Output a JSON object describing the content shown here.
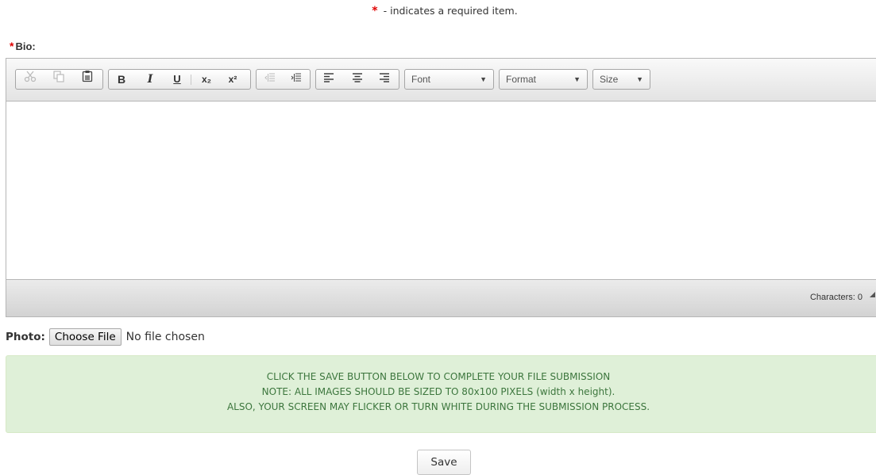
{
  "required_note": {
    "star": "*",
    "text": "- indicates a required item."
  },
  "bio": {
    "star": "*",
    "label": "Bio:"
  },
  "toolbar": {
    "cut_icon": "scissors-icon",
    "copy_icon": "copy-icon",
    "paste_icon": "paste-icon",
    "bold": "B",
    "italic": "I",
    "underline": "U",
    "subscript": "x₂",
    "superscript": "x²",
    "outdent_icon": "outdent-icon",
    "indent_icon": "indent-icon",
    "align_left_icon": "align-left-icon",
    "align_center_icon": "align-center-icon",
    "align_right_icon": "align-right-icon",
    "font": "Font",
    "format": "Format",
    "size": "Size"
  },
  "editor": {
    "content": "",
    "char_count": "Characters: 0"
  },
  "photo": {
    "label": "Photo:",
    "button": "Choose File",
    "status": "No file chosen"
  },
  "notice": {
    "lines": [
      "CLICK THE SAVE BUTTON BELOW TO COMPLETE YOUR FILE SUBMISSION",
      "NOTE: ALL IMAGES SHOULD BE SIZED TO 80x100 PIXELS (width x height).",
      "ALSO, YOUR SCREEN MAY FLICKER OR TURN WHITE DURING THE SUBMISSION PROCESS."
    ]
  },
  "save_button": "Save",
  "colors": {
    "required_star": "#e00000",
    "notice_bg": "#dff0d8",
    "notice_text": "#3c763d"
  }
}
